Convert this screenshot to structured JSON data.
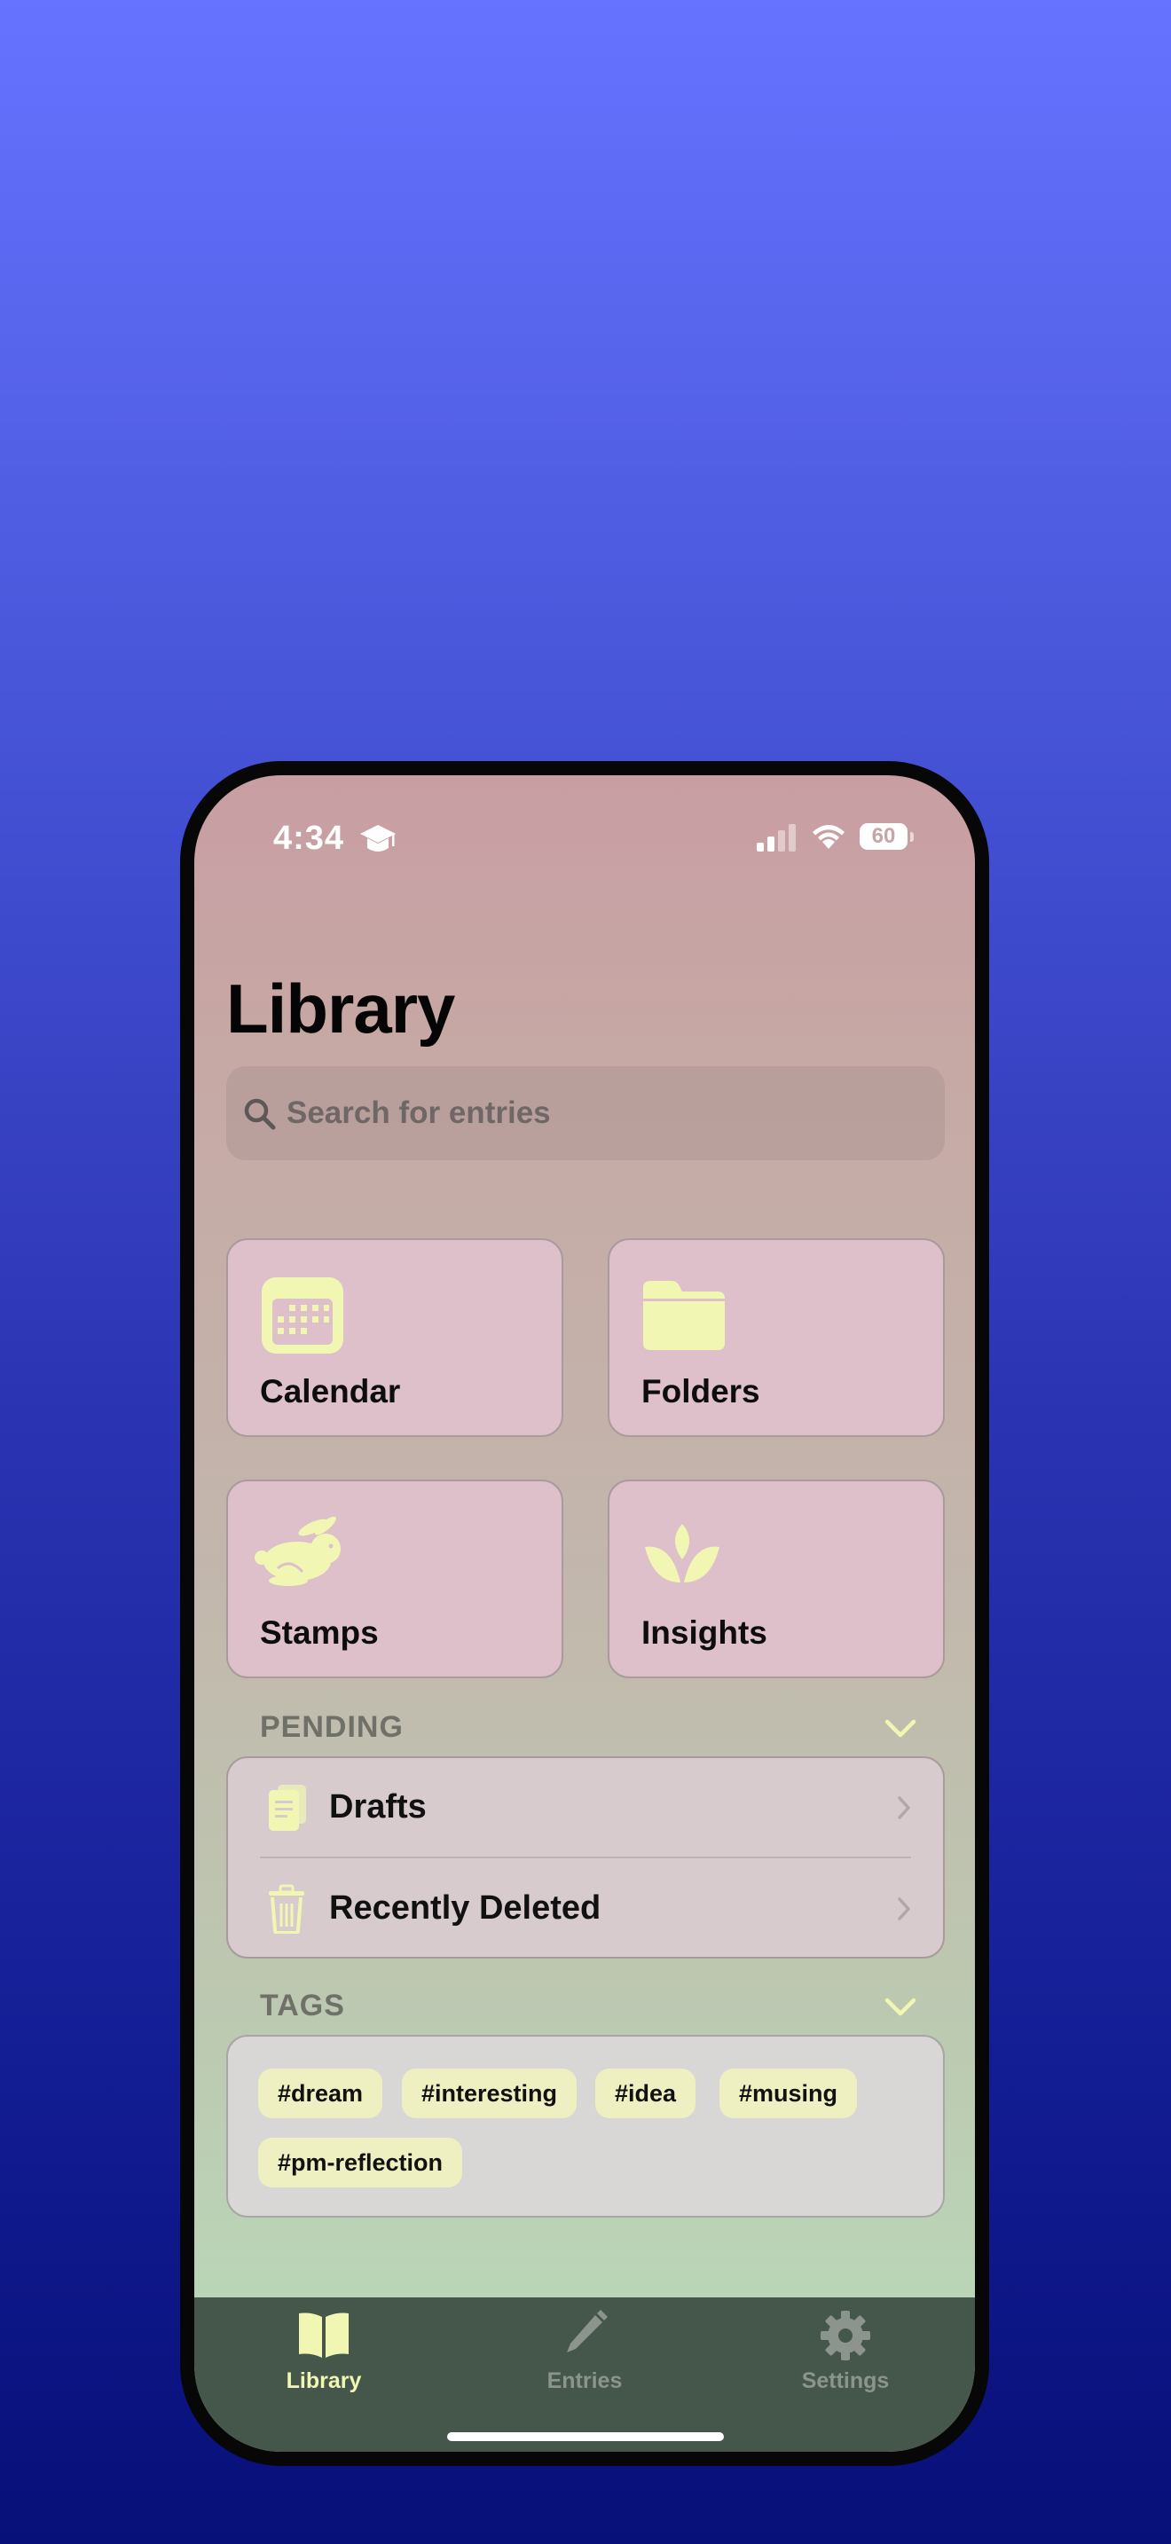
{
  "status_bar": {
    "time": "4:34",
    "battery": "60"
  },
  "header": {
    "title": "Library"
  },
  "search": {
    "placeholder": "Search for entries"
  },
  "tiles": [
    {
      "label": "Calendar",
      "icon": "calendar-icon"
    },
    {
      "label": "Folders",
      "icon": "folder-icon"
    },
    {
      "label": "Stamps",
      "icon": "rabbit-icon"
    },
    {
      "label": "Insights",
      "icon": "lotus-icon"
    }
  ],
  "pending": {
    "title": "PENDING",
    "items": [
      {
        "label": "Drafts",
        "icon": "document-icon"
      },
      {
        "label": "Recently Deleted",
        "icon": "trash-icon"
      }
    ]
  },
  "tags": {
    "title": "TAGS",
    "items": [
      "#dream",
      "#interesting",
      "#idea",
      "#musing",
      "#pm-reflection"
    ]
  },
  "tabbar": {
    "items": [
      {
        "label": "Library",
        "icon": "book-icon",
        "active": true
      },
      {
        "label": "Entries",
        "icon": "pencil-icon",
        "active": false
      },
      {
        "label": "Settings",
        "icon": "gear-icon",
        "active": false
      }
    ]
  },
  "colors": {
    "accent": "#f1f7b3",
    "tab_bar": "#45574a",
    "tile_bg": "#ddc0ca",
    "tag_bg": "#eef0c2",
    "inactive_tab": "#8b948d"
  }
}
